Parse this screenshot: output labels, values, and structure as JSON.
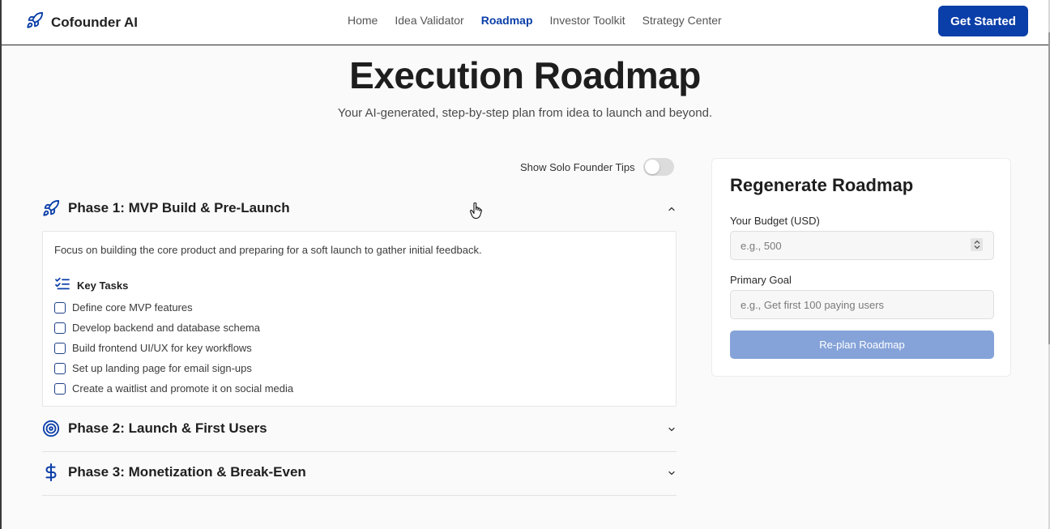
{
  "brand": {
    "name": "Cofounder AI",
    "icon": "rocket-icon"
  },
  "nav": {
    "items": [
      {
        "label": "Home",
        "active": false
      },
      {
        "label": "Idea Validator",
        "active": false
      },
      {
        "label": "Roadmap",
        "active": true
      },
      {
        "label": "Investor Toolkit",
        "active": false
      },
      {
        "label": "Strategy Center",
        "active": false
      }
    ],
    "cta": "Get Started"
  },
  "hero": {
    "title": "Execution Roadmap",
    "subtitle": "Your AI-generated, step-by-step plan from idea to launch and beyond."
  },
  "tips_toggle": {
    "label": "Show Solo Founder Tips",
    "on": false
  },
  "phases": [
    {
      "title": "Phase 1: MVP Build & Pre-Launch",
      "icon": "rocket-icon",
      "expanded": true,
      "description": "Focus on building the core product and preparing for a soft launch to gather initial feedback.",
      "tasks_heading": "Key Tasks",
      "tasks": [
        {
          "label": "Define core MVP features",
          "checked": false
        },
        {
          "label": "Develop backend and database schema",
          "checked": false
        },
        {
          "label": "Build frontend UI/UX for key workflows",
          "checked": false
        },
        {
          "label": "Set up landing page for email sign-ups",
          "checked": false
        },
        {
          "label": "Create a waitlist and promote it on social media",
          "checked": false
        }
      ]
    },
    {
      "title": "Phase 2: Launch & First Users",
      "icon": "target-icon",
      "expanded": false
    },
    {
      "title": "Phase 3: Monetization & Break-Even",
      "icon": "dollar-icon",
      "expanded": false
    }
  ],
  "regenerate": {
    "title": "Regenerate Roadmap",
    "budget_label": "Your Budget (USD)",
    "budget_placeholder": "e.g., 500",
    "goal_label": "Primary Goal",
    "goal_placeholder": "e.g., Get first 100 paying users",
    "button": "Re-plan Roadmap"
  },
  "colors": {
    "primary": "#0a3ea8",
    "button_disabled": "#85a3d9",
    "background": "#fafafa"
  }
}
